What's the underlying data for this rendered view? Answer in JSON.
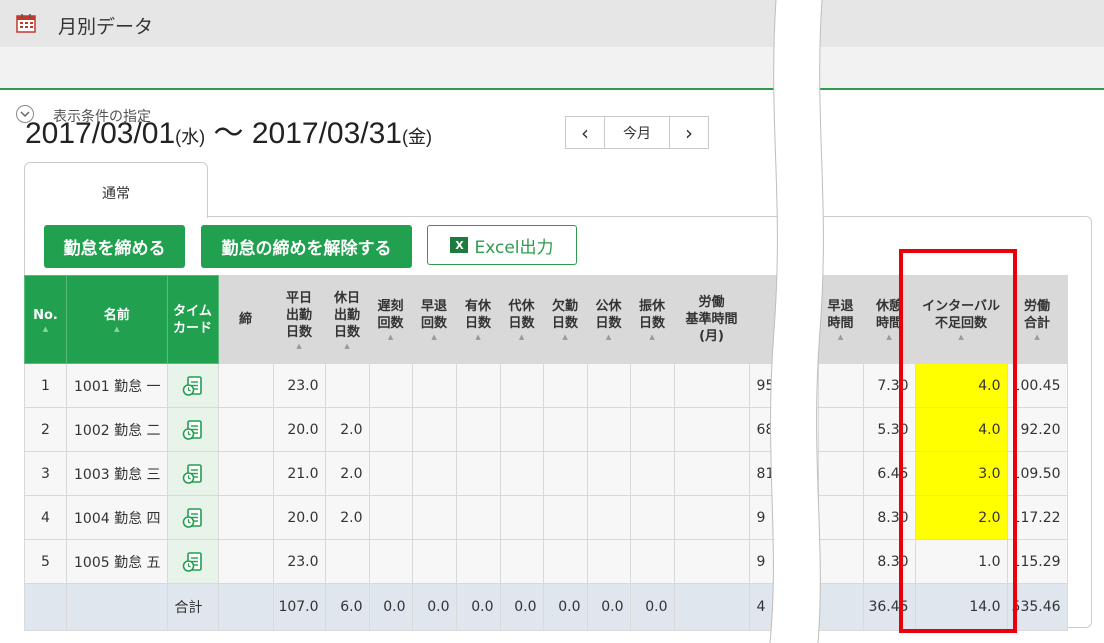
{
  "header": {
    "title": "月別データ",
    "icon": "calendar-icon"
  },
  "filter": {
    "label": "表示条件の指定",
    "icon": "chevron-down-icon"
  },
  "period": {
    "start": "2017/03/01",
    "start_dow": "(水)",
    "sep": "〜",
    "end": "2017/03/31",
    "end_dow": "(金)"
  },
  "pager": {
    "prev": "‹",
    "today": "今月",
    "next": "›"
  },
  "tabs": [
    {
      "label": "通常"
    }
  ],
  "buttons": {
    "close": "勤怠を締める",
    "unclose": "勤怠の締めを解除する",
    "excel": "Excel出力"
  },
  "table": {
    "headers": {
      "no": "No.",
      "name": "名前",
      "timecard": [
        "タイム",
        "カード"
      ],
      "close": "締",
      "weekday_days": [
        "平日",
        "出勤",
        "日数"
      ],
      "holiday_days": [
        "休日",
        "出勤",
        "日数"
      ],
      "late_count": [
        "遅刻",
        "回数"
      ],
      "early_count": [
        "早退",
        "回数"
      ],
      "paid_days": [
        "有休",
        "日数"
      ],
      "comp_days": [
        "代休",
        "日数"
      ],
      "absent_days": [
        "欠勤",
        "日数"
      ],
      "public_days": [
        "公休",
        "日数"
      ],
      "transfer_days": [
        "振休",
        "日数"
      ],
      "std_hours": [
        "労働",
        "基準時間",
        "(月)"
      ],
      "early_time": [
        "早退",
        "時間"
      ],
      "break_time": [
        "休憩",
        "時間"
      ],
      "interval_short": [
        "インターバル",
        "不足回数"
      ],
      "work_total": [
        "労働",
        "合計"
      ]
    },
    "rows": [
      {
        "no": "1",
        "name": "1001 勤怠 一",
        "weekday_days": "23.0",
        "holiday_days": "",
        "cut_col": "95",
        "break_time": "7.30",
        "interval_short": "4.0",
        "work_total": "100.45",
        "highlight": true
      },
      {
        "no": "2",
        "name": "1002 勤怠 二",
        "weekday_days": "20.0",
        "holiday_days": "2.0",
        "cut_col": "68",
        "break_time": "5.30",
        "interval_short": "4.0",
        "work_total": "92.20",
        "highlight": true
      },
      {
        "no": "3",
        "name": "1003 勤怠 三",
        "weekday_days": "21.0",
        "holiday_days": "2.0",
        "cut_col": "81",
        "break_time": "6.45",
        "interval_short": "3.0",
        "work_total": "109.50",
        "highlight": true
      },
      {
        "no": "4",
        "name": "1004 勤怠 四",
        "weekday_days": "20.0",
        "holiday_days": "2.0",
        "cut_col": "9",
        "break_time": "8.30",
        "interval_short": "2.0",
        "work_total": "117.22",
        "highlight": true
      },
      {
        "no": "5",
        "name": "1005 勤怠 五",
        "weekday_days": "23.0",
        "holiday_days": "",
        "cut_col": "9",
        "break_time": "8.30",
        "interval_short": "1.0",
        "work_total": "115.29",
        "highlight": false
      }
    ],
    "total": {
      "label": "合計",
      "weekday_days": "107.0",
      "holiday_days": "6.0",
      "late_count": "0.0",
      "early_count": "0.0",
      "paid_days": "0.0",
      "comp_days": "0.0",
      "absent_days": "0.0",
      "public_days": "0.0",
      "transfer_days": "0.0",
      "cut_col": "4",
      "break_time": "36.45",
      "interval_short": "14.0",
      "work_total": "535.46"
    }
  },
  "colors": {
    "accent": "#21a04f",
    "highlight": "#ffff00",
    "annotation": "#e8000b"
  }
}
